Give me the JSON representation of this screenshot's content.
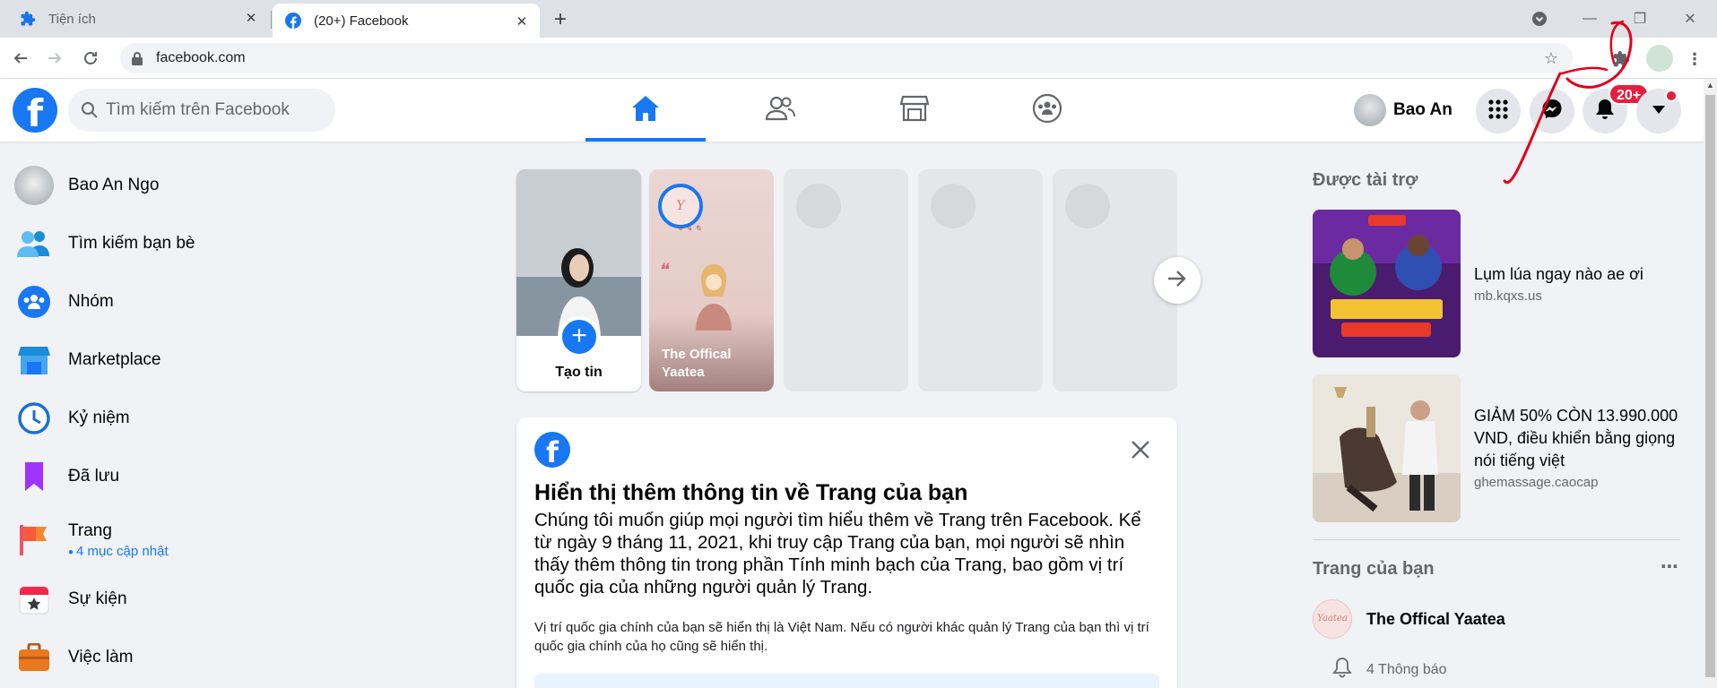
{
  "browser": {
    "tabs": [
      {
        "title": "Tiện ích",
        "icon": "puzzle-icon"
      },
      {
        "title": "(20+) Facebook",
        "icon": "facebook-icon"
      }
    ],
    "url": "facebook.com"
  },
  "header": {
    "search_placeholder": "Tìm kiếm trên Facebook",
    "nav_tabs": [
      "home-icon",
      "friends-icon",
      "marketplace-icon",
      "groups-icon"
    ],
    "profile_name": "Bao An",
    "notification_badge": "20+"
  },
  "sidebar": {
    "items": [
      {
        "label": "Bao An Ngo",
        "icon": "avatar"
      },
      {
        "label": "Tìm kiếm bạn bè",
        "icon": "friends-icon"
      },
      {
        "label": "Nhóm",
        "icon": "groups-icon"
      },
      {
        "label": "Marketplace",
        "icon": "marketplace-icon"
      },
      {
        "label": "Kỷ niệm",
        "icon": "memories-icon"
      },
      {
        "label": "Đã lưu",
        "icon": "saved-icon"
      },
      {
        "label": "Trang",
        "icon": "pages-flag-icon",
        "sub": "4 mục cập nhật"
      },
      {
        "label": "Sự kiện",
        "icon": "events-icon"
      },
      {
        "label": "Việc làm",
        "icon": "jobs-icon"
      }
    ]
  },
  "stories": {
    "create_label": "Tạo tin",
    "page_story_name": "The Offical Yaatea"
  },
  "info_card": {
    "title": "Hiển thị thêm thông tin về Trang của bạn",
    "body": "Chúng tôi muốn giúp mọi người tìm hiểu thêm về Trang trên Facebook. Kể từ ngày 9 tháng 11, 2021, khi truy cập Trang của bạn, mọi người sẽ nhìn thấy thêm thông tin trong phần Tính minh bạch của Trang, bao gồm vị trí quốc gia của những người quản lý Trang.",
    "small": "Vị trí quốc gia chính của bạn sẽ hiển thị là Việt Nam. Nếu có người khác quản lý Trang của bạn thì vị trí quốc gia chính của họ cũng sẽ hiển thị."
  },
  "right": {
    "sponsored_heading": "Được tài trợ",
    "ads": [
      {
        "text": "Lụm lúa ngay nào ae ơi",
        "domain": "mb.kqxs.us"
      },
      {
        "text": "GIẢM 50% CÒN 13.990.000 VND, điều khiển bằng giọng nói tiếng việt",
        "domain": "ghemassage.caocap"
      }
    ],
    "your_pages_heading": "Trang của bạn",
    "page_name": "The Offical Yaatea",
    "page_notifications": "4 Thông báo"
  },
  "colors": {
    "accent": "#1877f2",
    "badge": "#e41e3f",
    "page_bg": "#f0f2f5"
  }
}
